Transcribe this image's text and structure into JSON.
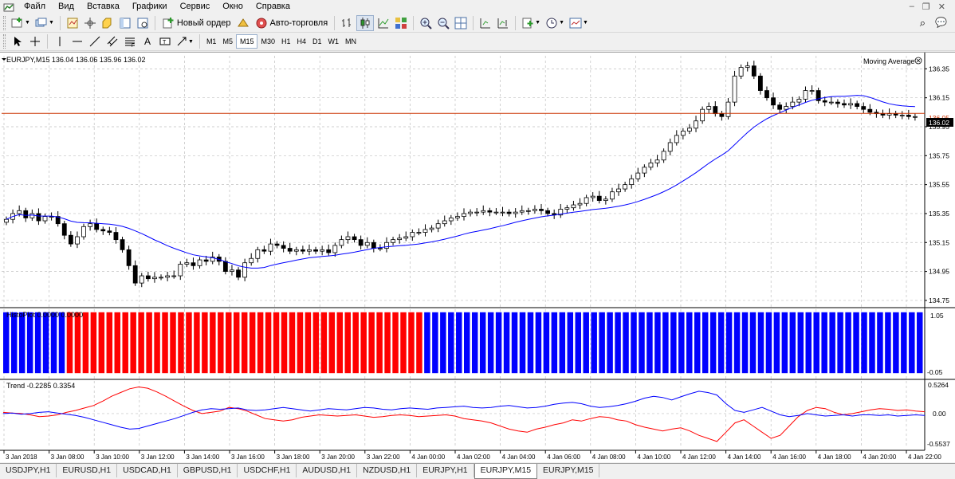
{
  "menu": {
    "items": [
      "Файл",
      "Вид",
      "Вставка",
      "Графики",
      "Сервис",
      "Окно",
      "Справка"
    ]
  },
  "toolbar": {
    "new_order_label": "Новый ордер",
    "autotrading_label": "Авто-торговля",
    "timeframes": [
      "M1",
      "M5",
      "M15",
      "M30",
      "H1",
      "H4",
      "D1",
      "W1",
      "MN"
    ],
    "active_timeframe": "M15",
    "text_tool_label": "A"
  },
  "chart": {
    "info_line": "EURJPY,M15  136.04 136.06 135.96 136.02",
    "indicator_label": "Moving Average",
    "current_price_label": "136.02",
    "bid_line_label": "136.05",
    "price_axis": [
      "136.35",
      "136.15",
      "135.95",
      "135.75",
      "135.55",
      "135.35",
      "135.15",
      "134.95",
      "134.75"
    ],
    "histogram_label": "HistoPlot 0.0000 0.0000",
    "histogram_axis_top": "1.05",
    "histogram_axis_bottom": "-0.05",
    "trend_label": "Trend -0.2285 0.3354",
    "trend_axis_top": "0.5264",
    "trend_axis_mid": "0.00",
    "trend_axis_bottom": "-0.5537",
    "time_axis": [
      "3 Jan 2018",
      "3 Jan 08:00",
      "3 Jan 10:00",
      "3 Jan 12:00",
      "3 Jan 14:00",
      "3 Jan 16:00",
      "3 Jan 18:00",
      "3 Jan 20:00",
      "3 Jan 22:00",
      "4 Jan 00:00",
      "4 Jan 02:00",
      "4 Jan 04:00",
      "4 Jan 06:00",
      "4 Jan 08:00",
      "4 Jan 10:00",
      "4 Jan 12:00",
      "4 Jan 14:00",
      "4 Jan 16:00",
      "4 Jan 18:00",
      "4 Jan 20:00",
      "4 Jan 22:00"
    ],
    "colors": {
      "candle": "#000000",
      "moving_average": "#0000ff",
      "price_line": "#cc3300",
      "hist_red": "#ff0000",
      "hist_blue": "#0000ff",
      "trend_red": "#ff0000",
      "trend_blue": "#0000ff",
      "grid": "#c0c0c0"
    }
  },
  "chart_data": [
    {
      "type": "candlestick",
      "symbol": "EURJPY",
      "timeframe": "M15",
      "ylim": [
        134.7,
        136.44
      ],
      "close": [
        135.31,
        135.35,
        135.37,
        135.32,
        135.35,
        135.3,
        135.33,
        135.33,
        135.28,
        135.2,
        135.14,
        135.19,
        135.26,
        135.28,
        135.24,
        135.23,
        135.22,
        135.17,
        135.1,
        134.99,
        134.87,
        134.92,
        134.9,
        134.91,
        134.91,
        134.92,
        134.92,
        135.0,
        135.01,
        134.99,
        135.03,
        135.02,
        135.05,
        135.02,
        134.95,
        134.96,
        134.91,
        135.01,
        135.04,
        135.1,
        135.09,
        135.14,
        135.13,
        135.11,
        135.09,
        135.1,
        135.09,
        135.1,
        135.09,
        135.1,
        135.08,
        135.13,
        135.17,
        135.19,
        135.17,
        135.13,
        135.15,
        135.11,
        135.11,
        135.15,
        135.17,
        135.18,
        135.19,
        135.22,
        135.22,
        135.24,
        135.25,
        135.28,
        135.3,
        135.32,
        135.33,
        135.35,
        135.36,
        135.36,
        135.37,
        135.36,
        135.36,
        135.36,
        135.35,
        135.36,
        135.37,
        135.37,
        135.38,
        135.37,
        135.35,
        135.34,
        135.38,
        135.39,
        135.41,
        135.42,
        135.46,
        135.47,
        135.44,
        135.45,
        135.5,
        135.52,
        135.55,
        135.59,
        135.63,
        135.67,
        135.7,
        135.72,
        135.78,
        135.84,
        135.89,
        135.92,
        135.94,
        135.99,
        136.07,
        136.09,
        136.04,
        136.02,
        136.12,
        136.3,
        136.36,
        136.37,
        136.3,
        136.2,
        136.15,
        136.1,
        136.07,
        136.09,
        136.12,
        136.14,
        136.2,
        136.2,
        136.13,
        136.12,
        136.12,
        136.11,
        136.1,
        136.11,
        136.09,
        136.07,
        136.05,
        136.04,
        136.03,
        136.04,
        136.03,
        136.03,
        136.02,
        136.02
      ]
    },
    {
      "type": "histogram",
      "name": "HistoPlot",
      "ylim": [
        -0.05,
        1.05
      ],
      "segments": [
        {
          "color": "blue",
          "bars": 8,
          "value": 1.0
        },
        {
          "color": "red",
          "bars": 45,
          "value": 1.0
        },
        {
          "color": "blue",
          "bars": 63,
          "value": 1.0
        }
      ]
    },
    {
      "type": "line",
      "name": "Trend",
      "ylim": [
        -0.5537,
        0.5264
      ],
      "series": [
        {
          "name": "red",
          "values": [
            0.02,
            0.01,
            0.0,
            -0.02,
            -0.05,
            -0.04,
            -0.02,
            0.02,
            0.05,
            0.09,
            0.13,
            0.2,
            0.28,
            0.34,
            0.4,
            0.43,
            0.41,
            0.35,
            0.28,
            0.2,
            0.12,
            0.05,
            0.0,
            0.02,
            0.04,
            0.1,
            0.08,
            0.04,
            -0.02,
            -0.08,
            -0.1,
            -0.12,
            -0.1,
            -0.06,
            -0.04,
            -0.02,
            -0.03,
            -0.04,
            -0.03,
            -0.02,
            -0.04,
            -0.06,
            -0.05,
            -0.03,
            -0.02,
            -0.03,
            -0.05,
            -0.04,
            -0.03,
            -0.02,
            -0.04,
            -0.08,
            -0.1,
            -0.12,
            -0.15,
            -0.2,
            -0.25,
            -0.28,
            -0.3,
            -0.25,
            -0.22,
            -0.18,
            -0.15,
            -0.1,
            -0.12,
            -0.08,
            -0.05,
            -0.06,
            -0.1,
            -0.12,
            -0.18,
            -0.22,
            -0.25,
            -0.28,
            -0.25,
            -0.23,
            -0.28,
            -0.35,
            -0.4,
            -0.45,
            -0.3,
            -0.15,
            -0.1,
            -0.2,
            -0.3,
            -0.4,
            -0.35,
            -0.2,
            -0.05,
            0.05,
            0.1,
            0.08,
            0.02,
            -0.02,
            0.0,
            0.03,
            0.06,
            0.08,
            0.07,
            0.05,
            0.06,
            0.04,
            0.03
          ]
        },
        {
          "name": "blue",
          "values": [
            0.0,
            0.01,
            -0.01,
            0.0,
            0.02,
            0.03,
            0.01,
            -0.01,
            -0.03,
            -0.06,
            -0.1,
            -0.14,
            -0.18,
            -0.22,
            -0.25,
            -0.24,
            -0.2,
            -0.16,
            -0.12,
            -0.08,
            -0.03,
            0.02,
            0.06,
            0.08,
            0.07,
            0.08,
            0.09,
            0.06,
            0.05,
            0.06,
            0.08,
            0.1,
            0.08,
            0.06,
            0.04,
            0.06,
            0.08,
            0.07,
            0.06,
            0.08,
            0.1,
            0.09,
            0.07,
            0.06,
            0.08,
            0.09,
            0.08,
            0.07,
            0.09,
            0.1,
            0.11,
            0.12,
            0.1,
            0.09,
            0.1,
            0.12,
            0.13,
            0.11,
            0.09,
            0.1,
            0.12,
            0.15,
            0.17,
            0.18,
            0.16,
            0.12,
            0.1,
            0.11,
            0.13,
            0.16,
            0.2,
            0.25,
            0.28,
            0.26,
            0.22,
            0.27,
            0.32,
            0.36,
            0.34,
            0.3,
            0.16,
            0.05,
            0.02,
            0.06,
            0.1,
            0.04,
            -0.02,
            -0.05,
            -0.03,
            0.0,
            -0.02,
            -0.04,
            -0.03,
            -0.02,
            -0.04,
            -0.02,
            -0.02,
            -0.03,
            -0.02,
            -0.04,
            -0.03,
            -0.02,
            -0.03
          ]
        }
      ]
    }
  ]
}
